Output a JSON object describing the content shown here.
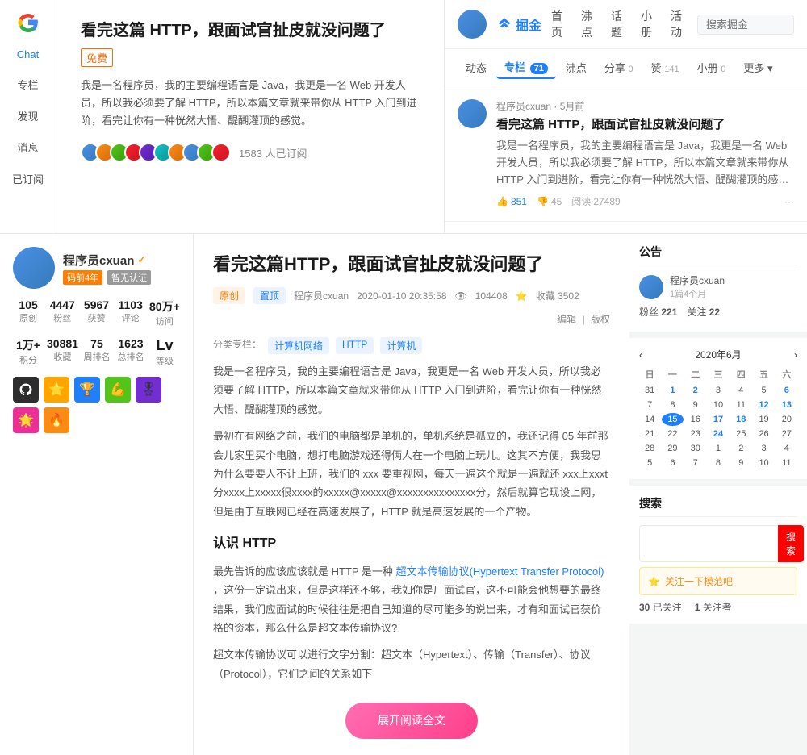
{
  "sidebar": {
    "chat_label": "Chat",
    "column_label": "专栏",
    "discover_label": "发现",
    "messages_label": "消息",
    "subscribed_label": "已订阅"
  },
  "top_article": {
    "title": "看完这篇 HTTP，跟面试官扯皮就没问题了",
    "tag": "免费",
    "description": "我是一名程序员，我的主要编程语言是 Java，我更是一名 Web 开发人员，所以我必须要了解 HTTP，所以本篇文章就来带你从 HTTP 入门到进阶，看完让你有一种恍然大悟、醍醐灌顶的感觉。",
    "subscribers": "1583 人已订阅"
  },
  "juejin_nav": {
    "logo_text": "掘金",
    "nav_items": [
      "首页",
      "沸点",
      "话题",
      "小册",
      "活动"
    ],
    "search_placeholder": "搜索掘金"
  },
  "juejin_sub_nav": {
    "items": [
      {
        "label": "动态",
        "active": false
      },
      {
        "label": "专栏",
        "count": "71",
        "active": true
      },
      {
        "label": "沸点",
        "active": false
      },
      {
        "label": "分享",
        "count": "0",
        "active": false
      },
      {
        "label": "赞",
        "count": "141",
        "active": false
      },
      {
        "label": "小册",
        "count": "0",
        "active": false
      },
      {
        "label": "更多",
        "active": false
      }
    ]
  },
  "feed_article": {
    "author": "程序员cxuan",
    "time": "· 5月前",
    "title": "看完这篇 HTTP，跟面试官扯皮就没问题了",
    "desc": "我是一名程序员，我的主要编程语言是 Java，我更是一名 Web 开发人员，所以我必须要了解 HTTP，所以本篇文章就来带你从 HTTP 入门到进阶，看完让你有一种恍然大悟、醍醐灌顶的感觉。最先在有网络之前，我们的电脑都是单机的，单机系统是孤立的，我还记得 05 年前那会儿家里买个电脑，想打电脑...",
    "likes": "851",
    "dislikes": "45",
    "views": "27489"
  },
  "author": {
    "name": "程序员cxuan",
    "verified": true,
    "tag1": "码前4年",
    "tag2": "智无认证",
    "stats": {
      "original": "105",
      "fans": "4447",
      "likes": "5967",
      "comments": "1103",
      "visits": "80万+"
    },
    "stats2": {
      "points": "1万+",
      "collections": "30881",
      "weekly_rank": "75",
      "total_rank": "1623",
      "level": "等级"
    },
    "stats_labels": {
      "original": "原创",
      "fans": "粉丝",
      "likes": "获赞",
      "comments": "评论",
      "visits": "访问"
    },
    "stats2_labels": {
      "points": "积分",
      "collections": "收藏",
      "weekly_rank": "周排名",
      "total_rank": "总排名",
      "level": "等级"
    }
  },
  "main_article": {
    "title": "看完这篇HTTP，跟面试官扯皮就没问题了",
    "tag_original": "原创",
    "tag_pinned": "置顶",
    "author": "程序员cxuan",
    "date": "2020-01-10 20:35:58",
    "views": "104408",
    "collections": "收藏 3502",
    "edit": "编辑",
    "rights": "版权",
    "categories": [
      "计算机网络",
      "HTTP",
      "计算机"
    ],
    "body_p1": "我是一名程序员，我的主要编程语言是 Java，我更是一名 Web 开发人员，所以我必须要了解 HTTP，所以本篇文章就来带你从 HTTP 入门到进阶，看完让你有一种恍然大悟、醍醐灌顶的感觉。",
    "body_p2": "最初在有网络之前，我们的电脑都是单机的，单机系统是孤立的，我还记得 05 年前那会儿家里买个电脑，想打电脑游戏还得俩人在一个电脑上玩儿。这其不方便，我我思为什么要要人不让上班，我们的 xxx 要重视网，每天一遍这个就是一遍就还 xxx上xxxt 分xxxx上xxxxx很xxxx的xxxxx@xxxxx@xxxxxxxxxxxxxxx分，然后就算它现设上网，但是由于互联网已经在高速发展了，HTTP 就是高速发展的一个产物。",
    "section_title": "认识 HTTP",
    "body_p3": "最先告诉的应该应该就是 HTTP 是一种",
    "hypertext_label": "超文本传输协议(Hypertext Transfer Protocol)",
    "body_p3_rest": "，这份一定说出来，但是这样还不够，我如你是厂面试官，这不可能会他想要的最终结果，我们应面试的时候往往是把自己知道的尽可能多的说出来，才有和面试官获价格的资本，那么什么是超文本传输协议?",
    "body_p4": "超文本传输协议可以进行文字分割：超文本（Hypertext）、传输（Transfer）、协议（Protocol），它们之间的关系如下"
  },
  "right_sidebar": {
    "announcement_title": "公告",
    "profile_name": "程序员cxuan",
    "profile_articles": "1篇4个月",
    "profile_fans": "221",
    "profile_following": "22",
    "calendar_title": "2020年6月",
    "calendar_days": [
      "日",
      "一",
      "二",
      "三",
      "四",
      "五",
      "六"
    ],
    "calendar_rows": [
      [
        "31",
        "1",
        "2",
        "3",
        "4",
        "5",
        "6"
      ],
      [
        "7",
        "8",
        "9",
        "10",
        "11",
        "12",
        "13"
      ],
      [
        "14",
        "15",
        "16",
        "17",
        "18",
        "19",
        "20"
      ],
      [
        "21",
        "22",
        "23",
        "24",
        "25",
        "26",
        "27"
      ],
      [
        "28",
        "29",
        "30",
        "1",
        "2",
        "3",
        "4"
      ],
      [
        "5",
        "6",
        "7",
        "8",
        "9",
        "10",
        "11"
      ]
    ],
    "today": "15",
    "search_title": "搜索",
    "follow_title": "关注一下模范吧",
    "follow_count": "30",
    "follower_count": "1"
  }
}
